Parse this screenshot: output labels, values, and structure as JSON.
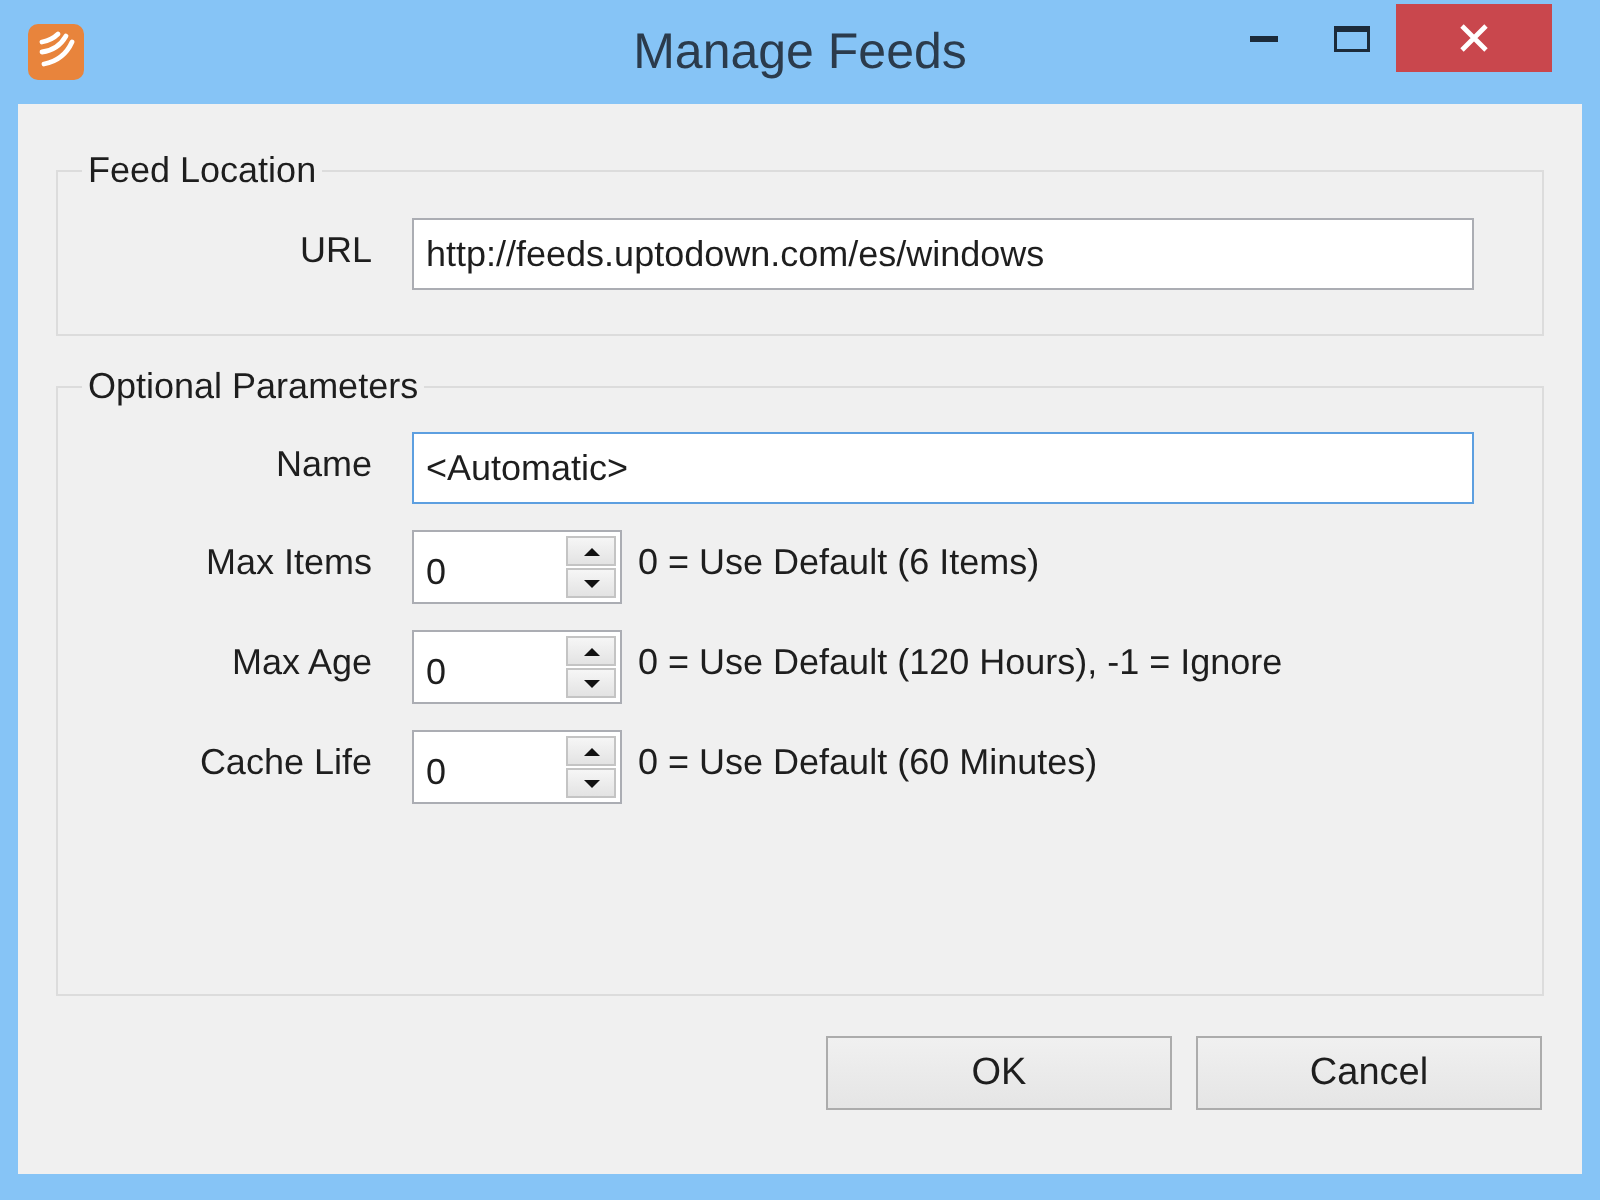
{
  "window": {
    "title": "Manage Feeds"
  },
  "feed_location": {
    "legend": "Feed Location",
    "url": {
      "label": "URL",
      "value": "http://feeds.uptodown.com/es/windows",
      "focused": false
    }
  },
  "optional_parameters": {
    "legend": "Optional Parameters",
    "name": {
      "label": "Name",
      "value": "<Automatic>",
      "focused": true
    },
    "spinners": [
      {
        "label": "Max Items",
        "value": "0",
        "hint": "0 = Use Default (6 Items)"
      },
      {
        "label": "Max Age",
        "value": "0",
        "hint": "0 = Use Default (120 Hours), -1 = Ignore"
      },
      {
        "label": "Cache Life",
        "value": "0",
        "hint": "0 = Use Default (60 Minutes)"
      }
    ]
  },
  "buttons": [
    {
      "label": "OK"
    },
    {
      "label": "Cancel"
    }
  ]
}
